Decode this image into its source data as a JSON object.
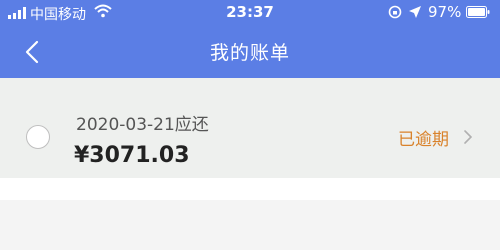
{
  "status_bar": {
    "carrier": "中国移动",
    "time": "23:37",
    "battery": "97%"
  },
  "header": {
    "title": "我的账单"
  },
  "bill": {
    "due_text": "2020-03-21应还",
    "amount": "¥3071.03",
    "status": "已逾期"
  },
  "colors": {
    "header_bg": "#5b7ee5",
    "status_orange": "#d9822b"
  }
}
